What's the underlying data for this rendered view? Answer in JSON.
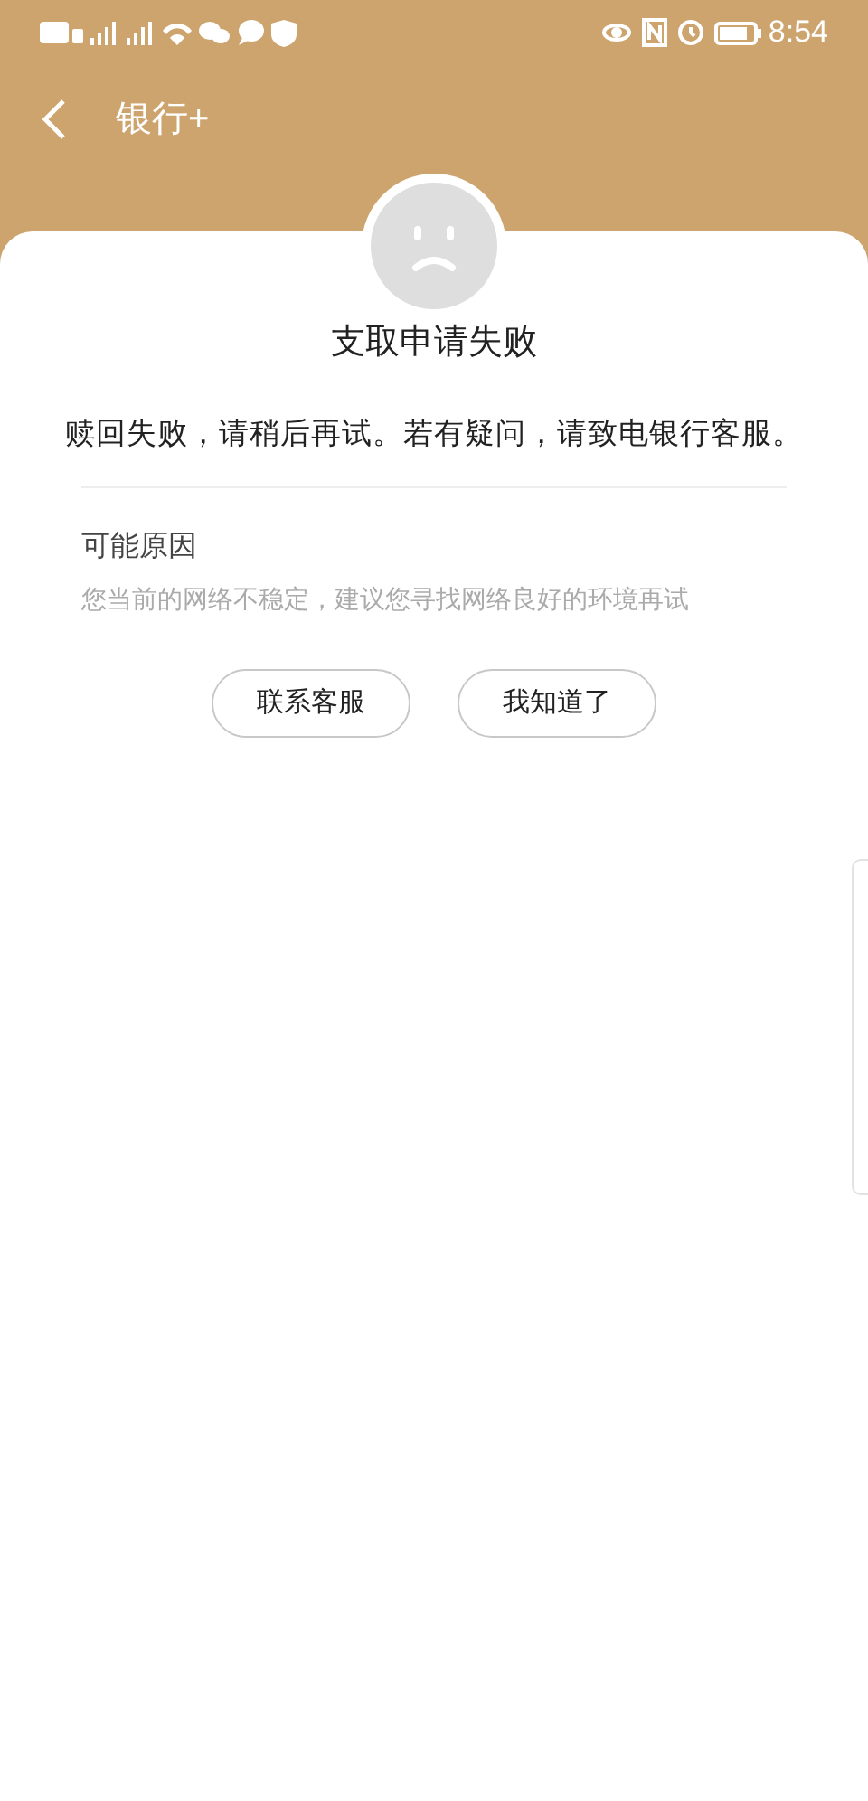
{
  "status_bar": {
    "time": "8:54"
  },
  "header": {
    "title": "银行+"
  },
  "dialog": {
    "title": "支取申请失败",
    "message": "赎回失败，请稍后再试。若有疑问，请致电银行客服。",
    "reason_title": "可能原因",
    "reason_text": "您当前的网络不稳定，建议您寻找网络良好的环境再试",
    "buttons": [
      {
        "label": "联系客服"
      },
      {
        "label": "我知道了"
      }
    ]
  }
}
